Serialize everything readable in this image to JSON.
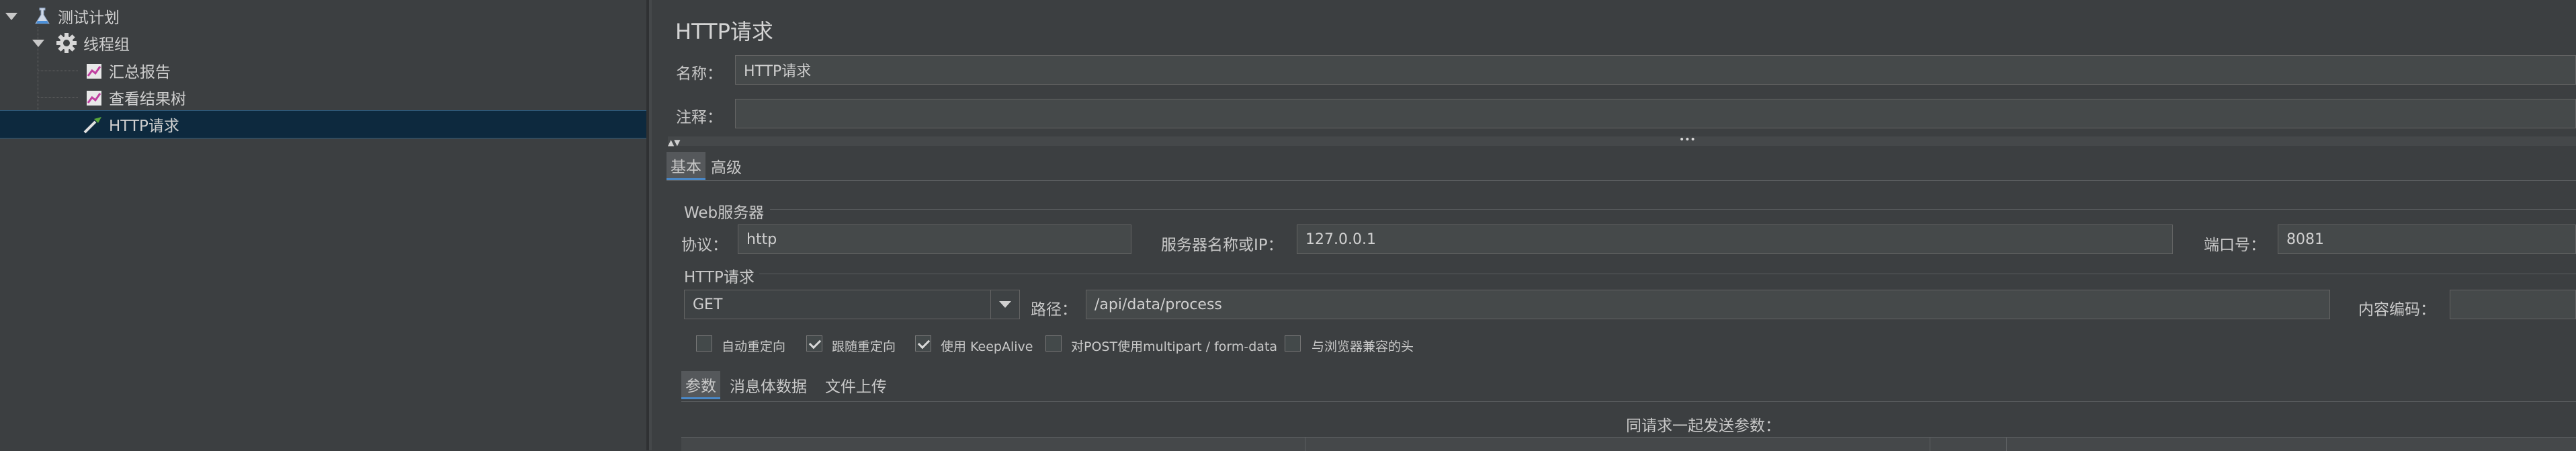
{
  "tree": {
    "items": [
      {
        "label": "测试计划",
        "icon": "test-plan-icon"
      },
      {
        "label": "线程组",
        "icon": "gear-icon"
      },
      {
        "label": "汇总报告",
        "icon": "report-chart-icon"
      },
      {
        "label": "查看结果树",
        "icon": "report-chart-icon"
      },
      {
        "label": "HTTP请求",
        "icon": "pipette-icon"
      }
    ]
  },
  "panel": {
    "title": "HTTP请求",
    "name_label": "名称：",
    "name_value": "HTTP请求",
    "comment_label": "注释：",
    "comment_value": "",
    "collapse_dots": "•••"
  },
  "tabs": {
    "basic": "基本",
    "advanced": "高级"
  },
  "web_server": {
    "section_title": "Web服务器",
    "protocol_label": "协议：",
    "protocol_value": "http",
    "server_label": "服务器名称或IP：",
    "server_value": "127.0.0.1",
    "port_label": "端口号：",
    "port_value": "8081"
  },
  "http_request": {
    "section_title": "HTTP请求",
    "method_value": "GET",
    "path_label": "路径：",
    "path_value": "/api/data/process",
    "encoding_label": "内容编码：",
    "encoding_value": ""
  },
  "options": [
    {
      "label": "自动重定向",
      "checked": false
    },
    {
      "label": "跟随重定向",
      "checked": true
    },
    {
      "label": "使用 KeepAlive",
      "checked": true
    },
    {
      "label": "对POST使用multipart / form-data",
      "checked": false
    },
    {
      "label": "与浏览器兼容的头",
      "checked": false
    }
  ],
  "sub_tabs": {
    "params": "参数",
    "body": "消息体数据",
    "upload": "文件上传"
  },
  "params_table": {
    "caption": "同请求一起发送参数："
  },
  "colors": {
    "background": "#3c3f41",
    "selection": "#0d293e",
    "field": "#45494a"
  }
}
